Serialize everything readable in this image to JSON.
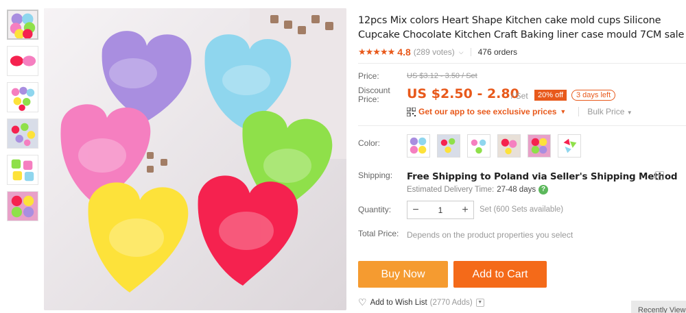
{
  "product": {
    "title": "12pcs Mix colors Heart Shape Kitchen cake mold cups Silicone Cupcake Chocolate Kitchen Craft Baking liner case mould 7CM sale",
    "stars": "★★★★★",
    "rating": "4.8",
    "votes": "(289 votes)",
    "orders": "476 orders"
  },
  "price": {
    "label": "Price:",
    "original": "US $3.12 - 3.50 / Set",
    "discount_label": "Discount Price:",
    "current": "US $2.50 - 2.80",
    "unit": "/ Set",
    "off_badge": "20% off",
    "days_left": "3 days left",
    "app_promo": "Get our app to see exclusive prices",
    "bulk_price": "Bulk Price"
  },
  "color": {
    "label": "Color:"
  },
  "shipping": {
    "label": "Shipping:",
    "method": "Free Shipping to Poland via Seller's Shipping Method",
    "eta_label": "Estimated Delivery Time:",
    "eta_days": "27-48 days",
    "help": "?"
  },
  "quantity": {
    "label": "Quantity:",
    "minus": "−",
    "value": "1",
    "plus": "+",
    "available": "Set (600 Sets available)"
  },
  "total": {
    "label": "Total Price:",
    "note": "Depends on the product properties you select"
  },
  "actions": {
    "buy_now": "Buy Now",
    "add_to_cart": "Add to Cart",
    "wishlist": "Add to Wish List",
    "wishlist_count": "(2770 Adds)"
  },
  "recently_viewed": "Recently Viewed",
  "colors": {
    "accent": "#e8591b",
    "buy_now": "#f59b30",
    "add_to_cart": "#f46a19",
    "purple": "#a98ee0",
    "blue": "#8fd6ee",
    "pink": "#f57fc0",
    "green": "#8fe04a",
    "yellow": "#fde23a",
    "red": "#f5224f"
  }
}
